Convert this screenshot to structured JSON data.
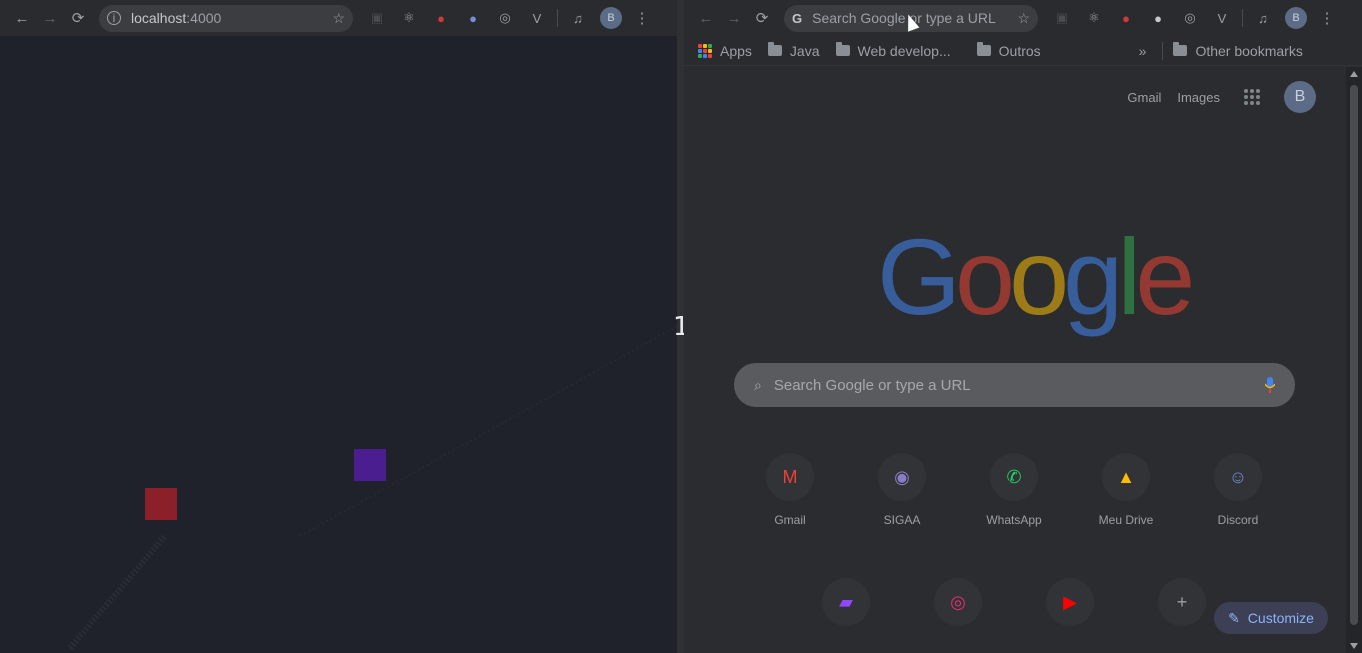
{
  "left_window": {
    "address": "localhost",
    "port": ":4000",
    "squares": [
      {
        "name": "red-square",
        "color": "#8b1f2a"
      },
      {
        "name": "purple-square",
        "color": "#4b1e8f"
      }
    ]
  },
  "split_label": "1",
  "right_window": {
    "omnibox_placeholder": "Search Google or type a URL",
    "bookmarks": {
      "apps": "Apps",
      "java": "Java",
      "web": "Web develop...",
      "outros": "Outros",
      "more": "»",
      "other": "Other bookmarks"
    },
    "header_links": {
      "gmail": "Gmail",
      "images": "Images",
      "avatar": "B"
    },
    "logo": [
      "G",
      "o",
      "o",
      "g",
      "l",
      "e"
    ],
    "logo_colors": [
      "#4285f4",
      "#ea4335",
      "#fbbc05",
      "#4285f4",
      "#34a853",
      "#ea4335"
    ],
    "search_placeholder": "Search Google or type a URL",
    "shortcuts_row1": [
      {
        "label": "Gmail",
        "icon": "gmail-icon"
      },
      {
        "label": "SIGAA",
        "icon": "sigaa-icon"
      },
      {
        "label": "WhatsApp",
        "icon": "whatsapp-icon"
      },
      {
        "label": "Meu Drive",
        "icon": "drive-icon"
      },
      {
        "label": "Discord",
        "icon": "discord-icon"
      }
    ],
    "shortcuts_row2": [
      {
        "label": "",
        "icon": "twitch-icon"
      },
      {
        "label": "",
        "icon": "instagram-icon"
      },
      {
        "label": "",
        "icon": "youtube-icon"
      },
      {
        "label": "",
        "icon": "add-shortcut-icon"
      }
    ],
    "customize_label": "Customize"
  }
}
